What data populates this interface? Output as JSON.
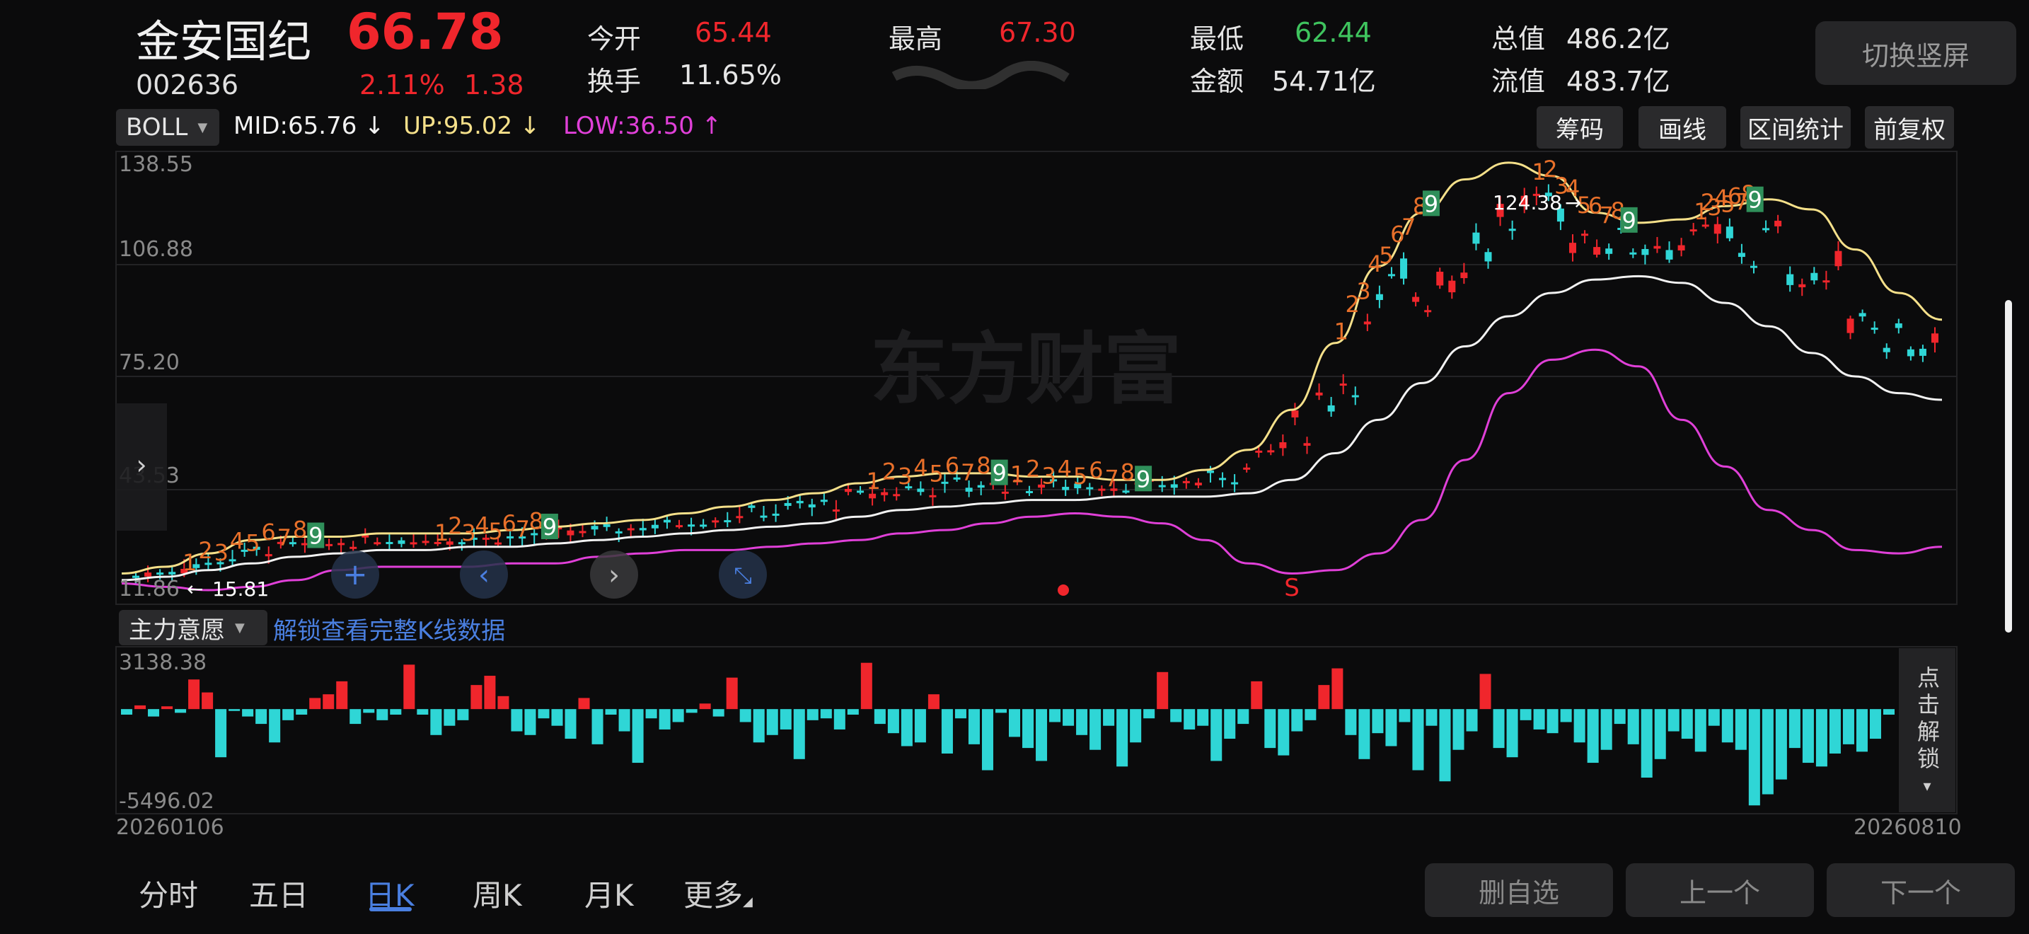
{
  "stock": {
    "name": "金安国纪",
    "price": "66.78",
    "code": "002636",
    "change_pct": "2.11%",
    "change": "1.38"
  },
  "quote": {
    "open_label": "今开",
    "open": "65.44",
    "high_label": "最高",
    "high": "67.30",
    "low_label": "最低",
    "low": "62.44",
    "total_value_label": "总值",
    "total_value": "486.2亿",
    "turnover_label": "换手",
    "turnover": "11.65%",
    "amount_label": "金额",
    "amount": "54.71亿",
    "float_value_label": "流值",
    "float_value": "483.7亿"
  },
  "rotate_button": "切换竖屏",
  "main_indicator": {
    "name": "BOLL",
    "mid": "MID:65.76",
    "up": "UP:95.02",
    "low": "LOW:36.50",
    "mid_color": "#f2f2f2",
    "up_color": "#f5e08a",
    "low_color": "#e040d8"
  },
  "chart_tools": [
    "筹码",
    "画线",
    "区间统计",
    "前复权"
  ],
  "main_axis": [
    "138.55",
    "106.88",
    "75.20",
    "43.53",
    "11.86"
  ],
  "annotations": {
    "max_label": "124.38",
    "min_label": "15.81",
    "signal_s": "S"
  },
  "watermark": "东方财富",
  "sub_indicator": {
    "name": "主力意愿",
    "unlock_text": "解锁查看完整K线数据",
    "axis_top": "3138.38",
    "axis_bottom": "-5496.02",
    "unlock_side": "点击解锁"
  },
  "date_range": {
    "start": "20260106",
    "end": "20260810"
  },
  "period_tabs": [
    {
      "label": "分时",
      "active": false
    },
    {
      "label": "五日",
      "active": false
    },
    {
      "label": "日K",
      "active": true
    },
    {
      "label": "周K",
      "active": false
    },
    {
      "label": "月K",
      "active": false
    },
    {
      "label": "更多",
      "active": false
    }
  ],
  "bottom_buttons": [
    "删自选",
    "上一个",
    "下一个"
  ],
  "colors": {
    "up": "#f0262c",
    "down": "#2fd6d6",
    "background": "#0b0b0c",
    "accent": "#4a7fe0"
  },
  "chart_data": [
    {
      "type": "line",
      "title": "",
      "y_ticks": [
        138.55,
        106.88,
        75.2,
        43.53,
        11.86
      ],
      "ylim": [
        11.86,
        138.55
      ],
      "x_range": [
        "20260106",
        "20260810"
      ],
      "series": [
        {
          "name": "MID",
          "values": [
            14,
            15,
            17,
            19,
            21,
            22,
            23,
            23,
            24,
            24,
            25,
            26,
            27,
            28,
            29,
            30,
            31,
            33,
            35,
            36,
            37,
            38,
            38,
            39,
            39,
            39,
            40,
            44,
            52,
            62,
            73,
            84,
            93,
            100,
            104,
            105,
            103,
            97,
            90,
            82,
            75,
            70,
            68
          ]
        },
        {
          "name": "UP",
          "values": [
            16,
            18,
            22,
            26,
            27,
            27,
            28,
            28,
            28,
            29,
            30,
            31,
            32,
            34,
            36,
            38,
            40,
            43,
            45,
            46,
            46,
            45,
            45,
            44,
            44,
            47,
            53,
            65,
            85,
            108,
            124,
            134,
            139,
            135,
            124,
            121,
            122,
            126,
            128,
            125,
            113,
            100,
            92
          ]
        },
        {
          "name": "LOW",
          "values": [
            13,
            12,
            11,
            12,
            14,
            17,
            18,
            18,
            18,
            19,
            19,
            21,
            22,
            23,
            23,
            24,
            25,
            26,
            28,
            29,
            31,
            33,
            34,
            33,
            31,
            26,
            19,
            16,
            17,
            22,
            32,
            50,
            70,
            80,
            83,
            78,
            62,
            48,
            35,
            29,
            23,
            22,
            24
          ]
        }
      ]
    },
    {
      "type": "bar",
      "title": "",
      "ylim": [
        -5496.02,
        3138.38
      ],
      "values": [
        -300,
        200,
        -400,
        150,
        -200,
        1600,
        900,
        -2600,
        -100,
        -400,
        -800,
        -1800,
        -600,
        -300,
        600,
        800,
        1500,
        -800,
        -200,
        -600,
        -300,
        2400,
        -300,
        -1400,
        -900,
        -600,
        1300,
        1800,
        700,
        -1200,
        -1400,
        -500,
        -900,
        -1600,
        600,
        -1900,
        -300,
        -1200,
        -2900,
        -500,
        -1100,
        -700,
        -200,
        300,
        -400,
        1700,
        -700,
        -1800,
        -1400,
        -1100,
        -2700,
        -600,
        -500,
        -1100,
        -300,
        2500,
        -800,
        -1300,
        -2000,
        -1800,
        800,
        -2400,
        -500,
        -1900,
        -3300,
        -200,
        -1500,
        -2100,
        -2800,
        -700,
        -900,
        -1400,
        -2200,
        -900,
        -3100,
        -1800,
        -500,
        2000,
        -700,
        -1100,
        -900,
        -2800,
        -1600,
        -800,
        1500,
        -2100,
        -2500,
        -1200,
        -600,
        1300,
        2200,
        -1400,
        -2700,
        -1300,
        -2000,
        -700,
        -3300,
        -900,
        -3900,
        -2200,
        -1200,
        1900,
        -2100,
        -2600,
        -600,
        -1100,
        -1300,
        -700,
        -1800,
        -2900,
        -2200,
        -800,
        -1900,
        -3700,
        -2700,
        -1200,
        -1600,
        -2300,
        -900,
        -1800,
        -2200,
        -5200,
        -4600,
        -3800,
        -2100,
        -2900,
        -3100,
        -2400,
        -1900,
        -2300,
        -1600,
        -300
      ]
    }
  ]
}
